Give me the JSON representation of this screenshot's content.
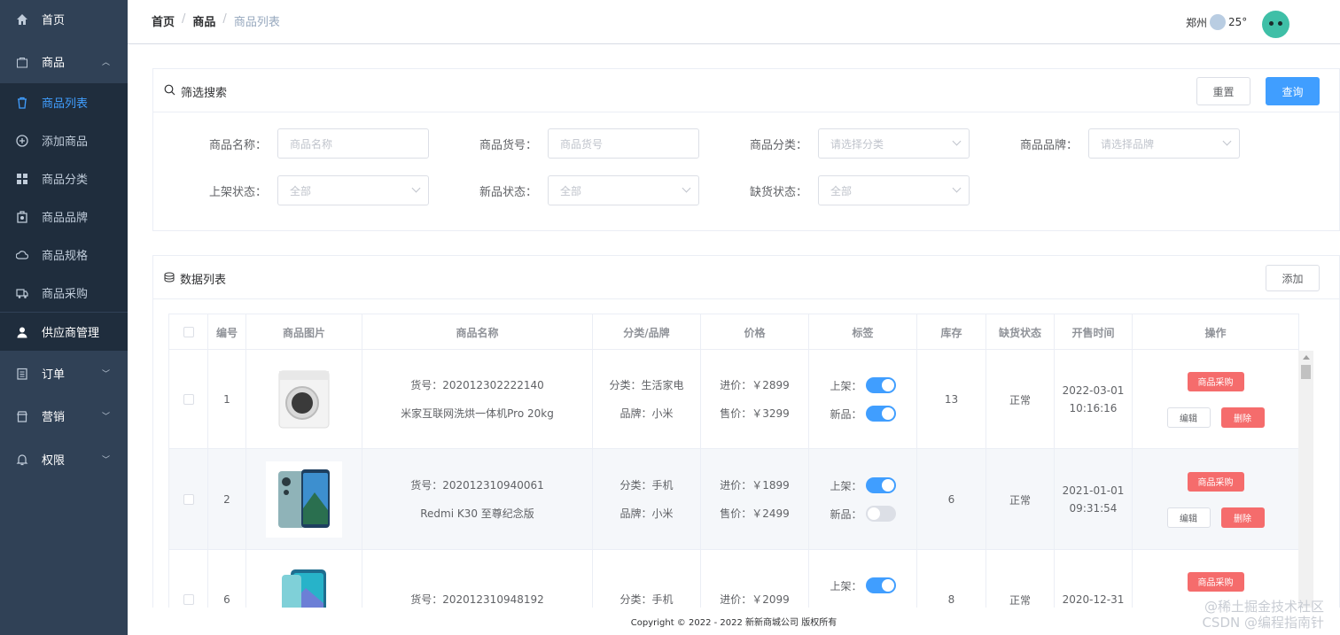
{
  "sidebar": {
    "items": [
      {
        "label": "首页"
      },
      {
        "label": "商品"
      },
      {
        "label": "商品列表"
      },
      {
        "label": "添加商品"
      },
      {
        "label": "商品分类"
      },
      {
        "label": "商品品牌"
      },
      {
        "label": "商品规格"
      },
      {
        "label": "商品采购"
      },
      {
        "label": "供应商管理"
      },
      {
        "label": "订单"
      },
      {
        "label": "营销"
      },
      {
        "label": "权限"
      }
    ]
  },
  "header": {
    "breadcrumb": [
      "首页",
      "商品",
      "商品列表"
    ],
    "weather_city": "郑州",
    "weather_temp": "25°"
  },
  "filter": {
    "title": "筛选搜索",
    "reset_label": "重置",
    "query_label": "查询",
    "fields": [
      {
        "label": "商品名称：",
        "placeholder": "商品名称"
      },
      {
        "label": "商品货号：",
        "placeholder": "商品货号"
      },
      {
        "label": "商品分类：",
        "placeholder": "请选择分类"
      },
      {
        "label": "商品品牌：",
        "placeholder": "请选择品牌"
      },
      {
        "label": "上架状态：",
        "placeholder": "全部"
      },
      {
        "label": "新品状态：",
        "placeholder": "全部"
      },
      {
        "label": "缺货状态：",
        "placeholder": "全部"
      }
    ]
  },
  "datalist": {
    "title": "数据列表",
    "add_label": "添加",
    "columns": [
      "编号",
      "商品图片",
      "商品名称",
      "分类/品牌",
      "价格",
      "标签",
      "库存",
      "缺货状态",
      "开售时间",
      "操作"
    ],
    "rows": [
      {
        "id": "1",
        "sku": "货号：202012302222140",
        "name": "米家互联网洗烘一体机Pro 20kg",
        "category": "分类：生活家电",
        "brand": "品牌：小米",
        "cost": "进价：￥2899",
        "price": "售价：￥3299",
        "shelf_label": "上架：",
        "shelf_on": true,
        "new_label": "新品：",
        "new_on": true,
        "stock": "13",
        "status": "正常",
        "date": "2022-03-01",
        "time": "10:16:16",
        "image": "washing-machine"
      },
      {
        "id": "2",
        "sku": "货号：202012310940061",
        "name": "Redmi K30 至尊纪念版",
        "category": "分类：手机",
        "brand": "品牌：小米",
        "cost": "进价：￥1899",
        "price": "售价：￥2499",
        "shelf_label": "上架：",
        "shelf_on": true,
        "new_label": "新品：",
        "new_on": false,
        "stock": "6",
        "status": "正常",
        "date": "2021-01-01",
        "time": "09:31:54",
        "image": "phone"
      },
      {
        "id": "6",
        "sku": "货号：202012310948192",
        "name": "",
        "category": "分类：手机",
        "brand": "",
        "cost": "进价：￥2099",
        "price": "",
        "shelf_label": "上架：",
        "shelf_on": true,
        "new_label": "",
        "new_on": null,
        "stock": "8",
        "status": "正常",
        "date": "2020-12-31",
        "time": "",
        "image": "phone"
      }
    ],
    "actions": {
      "purchase": "商品采购",
      "edit": "编辑",
      "delete": "删除"
    }
  },
  "footer": {
    "copyright": "Copyright © 2022 - 2022 新新商城公司 版权所有"
  },
  "watermark": {
    "line1": "@稀土掘金技术社区",
    "line2": "CSDN @编程指南针"
  },
  "colors": {
    "sidebar_bg": "#304156",
    "sidebar_sub_bg": "#1f2d3d",
    "accent": "#409eff",
    "danger": "#f56c6c"
  }
}
